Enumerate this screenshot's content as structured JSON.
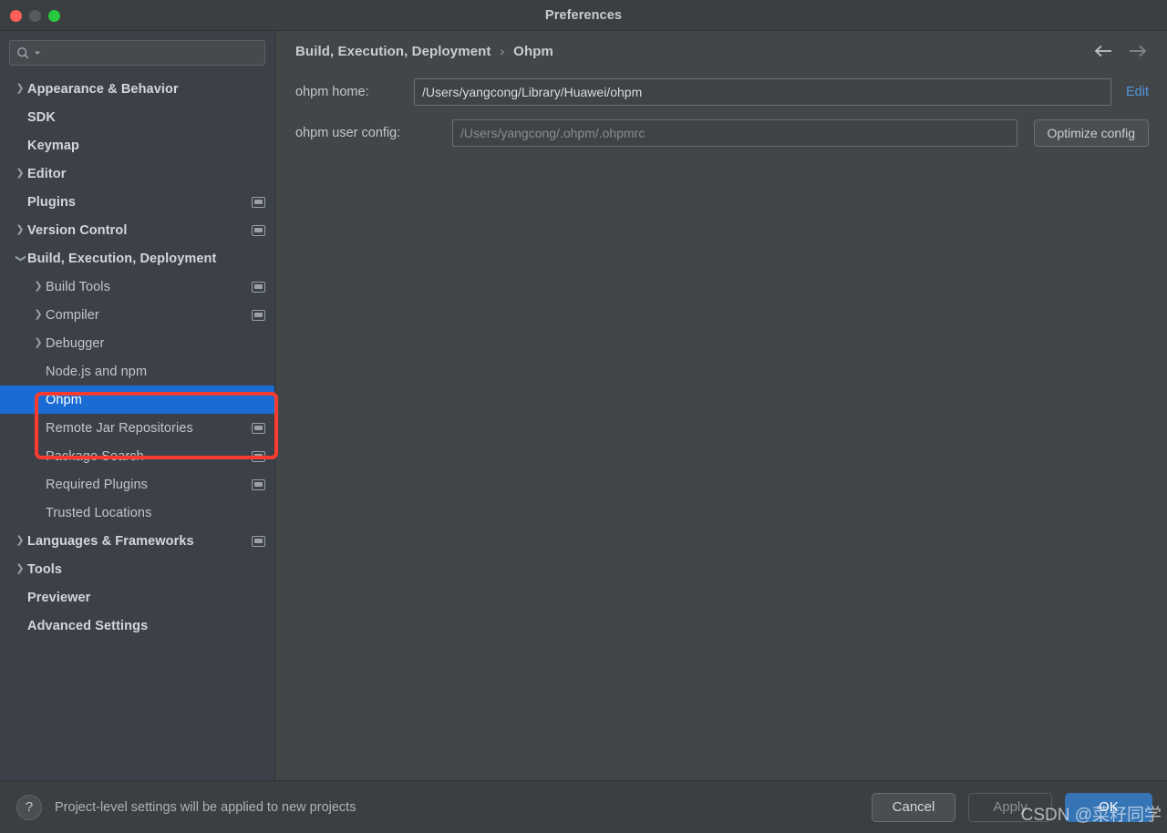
{
  "window": {
    "title": "Preferences",
    "traffic_lights": [
      "close-red",
      "minimize-grey",
      "zoom-green"
    ]
  },
  "sidebar": {
    "search": {
      "value": "",
      "placeholder": ""
    },
    "items": [
      {
        "label": "Appearance & Behavior",
        "arrow": "right",
        "indent": 0,
        "bold": true,
        "badge": false,
        "selected": false
      },
      {
        "label": "SDK",
        "arrow": "none",
        "indent": 0,
        "bold": true,
        "badge": false,
        "selected": false
      },
      {
        "label": "Keymap",
        "arrow": "none",
        "indent": 0,
        "bold": true,
        "badge": false,
        "selected": false
      },
      {
        "label": "Editor",
        "arrow": "right",
        "indent": 0,
        "bold": true,
        "badge": false,
        "selected": false
      },
      {
        "label": "Plugins",
        "arrow": "none",
        "indent": 0,
        "bold": true,
        "badge": true,
        "selected": false
      },
      {
        "label": "Version Control",
        "arrow": "right",
        "indent": 0,
        "bold": true,
        "badge": true,
        "selected": false
      },
      {
        "label": "Build, Execution, Deployment",
        "arrow": "down",
        "indent": 0,
        "bold": true,
        "badge": false,
        "selected": false
      },
      {
        "label": "Build Tools",
        "arrow": "right",
        "indent": 1,
        "bold": false,
        "badge": true,
        "selected": false
      },
      {
        "label": "Compiler",
        "arrow": "right",
        "indent": 1,
        "bold": false,
        "badge": true,
        "selected": false
      },
      {
        "label": "Debugger",
        "arrow": "right",
        "indent": 1,
        "bold": false,
        "badge": false,
        "selected": false
      },
      {
        "label": "Node.js and npm",
        "arrow": "none",
        "indent": 2,
        "bold": false,
        "badge": false,
        "selected": false
      },
      {
        "label": "Ohpm",
        "arrow": "none",
        "indent": 2,
        "bold": false,
        "badge": false,
        "selected": true
      },
      {
        "label": "Remote Jar Repositories",
        "arrow": "none",
        "indent": 2,
        "bold": false,
        "badge": true,
        "selected": false
      },
      {
        "label": "Package Search",
        "arrow": "none",
        "indent": 2,
        "bold": false,
        "badge": true,
        "selected": false
      },
      {
        "label": "Required Plugins",
        "arrow": "none",
        "indent": 2,
        "bold": false,
        "badge": true,
        "selected": false
      },
      {
        "label": "Trusted Locations",
        "arrow": "none",
        "indent": 2,
        "bold": false,
        "badge": false,
        "selected": false
      },
      {
        "label": "Languages & Frameworks",
        "arrow": "right",
        "indent": 0,
        "bold": true,
        "badge": true,
        "selected": false
      },
      {
        "label": "Tools",
        "arrow": "right",
        "indent": 0,
        "bold": true,
        "badge": false,
        "selected": false
      },
      {
        "label": "Previewer",
        "arrow": "none",
        "indent": 0,
        "bold": true,
        "badge": false,
        "selected": false
      },
      {
        "label": "Advanced Settings",
        "arrow": "none",
        "indent": 0,
        "bold": true,
        "badge": false,
        "selected": false
      }
    ],
    "selection_color": "#1a6bd4",
    "annotation_color": "#fb3b30"
  },
  "main": {
    "breadcrumb": {
      "root": "Build, Execution, Deployment",
      "separator": "›",
      "leaf": "Ohpm"
    },
    "nav": {
      "back_icon": "arrow-left-icon",
      "forward_icon": "arrow-right-icon"
    },
    "fields": {
      "home": {
        "label": "ohpm home:",
        "value": "/Users/yangcong/Library/Huawei/ohpm",
        "placeholder": "",
        "edit_link": "Edit",
        "link_color": "#4e96df"
      },
      "user_config": {
        "label": "ohpm user config:",
        "value": "",
        "placeholder": "/Users/yangcong/.ohpm/.ohpmrc",
        "button": "Optimize config"
      }
    }
  },
  "bottom": {
    "help_icon": "?",
    "hint": "Project-level settings will be applied to new projects",
    "cancel": "Cancel",
    "apply": "Apply",
    "ok": "OK",
    "ok_color": "#3574b5"
  },
  "watermark": "CSDN @菜籽同学"
}
